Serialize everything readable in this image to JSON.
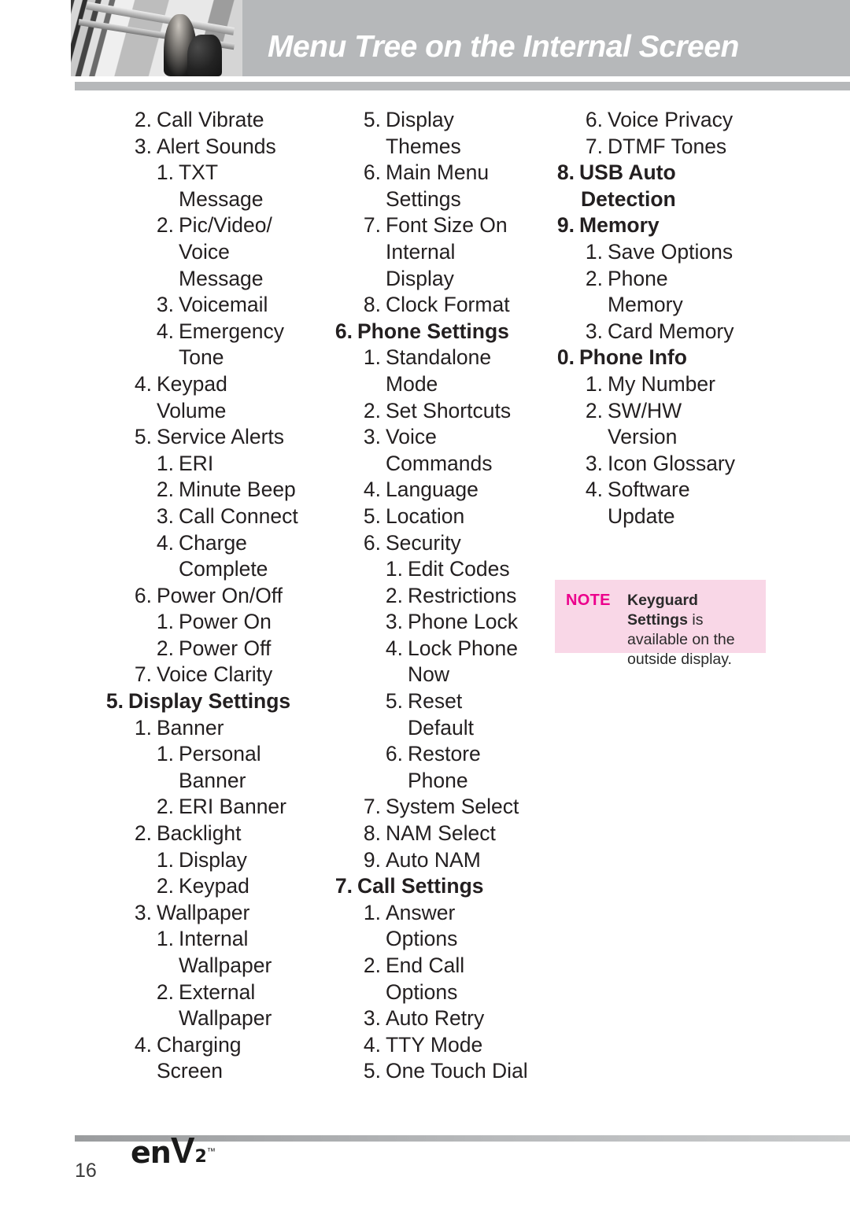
{
  "header": {
    "title": "Menu Tree on the Internal Screen",
    "photo_alt": "header-decorative-photo"
  },
  "columns": [
    {
      "id": "column-1",
      "entries": [
        {
          "level": 1,
          "num": "2.",
          "label": "Call Vibrate"
        },
        {
          "level": 1,
          "num": "3.",
          "label": "Alert Sounds"
        },
        {
          "level": 2,
          "num": "1.",
          "label": "TXT"
        },
        {
          "level": 2,
          "cont": true,
          "label": "Message"
        },
        {
          "level": 2,
          "num": "2.",
          "label": "Pic/Video/"
        },
        {
          "level": 2,
          "cont": true,
          "label": "Voice"
        },
        {
          "level": 2,
          "cont": true,
          "label": "Message"
        },
        {
          "level": 2,
          "num": "3.",
          "label": "Voicemail"
        },
        {
          "level": 2,
          "num": "4.",
          "label": "Emergency"
        },
        {
          "level": 2,
          "cont": true,
          "label": "Tone"
        },
        {
          "level": 1,
          "num": "4.",
          "label": "Keypad"
        },
        {
          "level": 1,
          "cont": true,
          "label": "Volume"
        },
        {
          "level": 1,
          "num": "5.",
          "label": "Service Alerts"
        },
        {
          "level": 2,
          "num": "1.",
          "label": "ERI"
        },
        {
          "level": 2,
          "num": "2.",
          "label": "Minute Beep"
        },
        {
          "level": 2,
          "num": "3.",
          "label": "Call Connect"
        },
        {
          "level": 2,
          "num": "4.",
          "label": "Charge"
        },
        {
          "level": 2,
          "cont": true,
          "label": "Complete"
        },
        {
          "level": 1,
          "num": "6.",
          "label": "Power On/Off"
        },
        {
          "level": 2,
          "num": "1.",
          "label": "Power On"
        },
        {
          "level": 2,
          "num": "2.",
          "label": "Power Off"
        },
        {
          "level": 1,
          "num": "7.",
          "label": "Voice Clarity"
        },
        {
          "level": 0,
          "num": "5.",
          "label": "Display Settings",
          "bold": true
        },
        {
          "level": 1,
          "num": "1.",
          "label": "Banner"
        },
        {
          "level": 2,
          "num": "1.",
          "label": "Personal"
        },
        {
          "level": 2,
          "cont": true,
          "label": "Banner"
        },
        {
          "level": 2,
          "num": "2.",
          "label": "ERI Banner"
        },
        {
          "level": 1,
          "num": "2.",
          "label": "Backlight"
        },
        {
          "level": 2,
          "num": "1.",
          "label": "Display"
        },
        {
          "level": 2,
          "num": "2.",
          "label": "Keypad"
        },
        {
          "level": 1,
          "num": "3.",
          "label": "Wallpaper"
        },
        {
          "level": 2,
          "num": "1.",
          "label": "Internal"
        },
        {
          "level": 2,
          "cont": true,
          "label": "Wallpaper"
        },
        {
          "level": 2,
          "num": "2.",
          "label": "External"
        },
        {
          "level": 2,
          "cont": true,
          "label": "Wallpaper"
        },
        {
          "level": 1,
          "num": "4.",
          "label": "Charging"
        },
        {
          "level": 1,
          "cont": true,
          "label": "Screen"
        }
      ]
    },
    {
      "id": "column-2",
      "entries": [
        {
          "level": 1,
          "num": "5.",
          "label": "Display"
        },
        {
          "level": 1,
          "cont": true,
          "label": "Themes"
        },
        {
          "level": 1,
          "num": "6.",
          "label": "Main Menu"
        },
        {
          "level": 1,
          "cont": true,
          "label": "Settings"
        },
        {
          "level": 1,
          "num": "7.",
          "label": "Font Size On"
        },
        {
          "level": 1,
          "cont": true,
          "label": "Internal"
        },
        {
          "level": 1,
          "cont": true,
          "label": "Display"
        },
        {
          "level": 1,
          "num": "8.",
          "label": "Clock Format"
        },
        {
          "level": 0,
          "num": "6.",
          "label": "Phone Settings",
          "bold": true
        },
        {
          "level": 1,
          "num": "1.",
          "label": "Standalone"
        },
        {
          "level": 1,
          "cont": true,
          "label": "Mode"
        },
        {
          "level": 1,
          "num": "2.",
          "label": "Set Shortcuts"
        },
        {
          "level": 1,
          "num": "3.",
          "label": "Voice"
        },
        {
          "level": 1,
          "cont": true,
          "label": "Commands"
        },
        {
          "level": 1,
          "num": "4.",
          "label": "Language"
        },
        {
          "level": 1,
          "num": "5.",
          "label": "Location"
        },
        {
          "level": 1,
          "num": "6.",
          "label": "Security"
        },
        {
          "level": 2,
          "num": "1.",
          "label": "Edit Codes"
        },
        {
          "level": 2,
          "num": "2.",
          "label": "Restrictions"
        },
        {
          "level": 2,
          "num": "3.",
          "label": "Phone Lock"
        },
        {
          "level": 2,
          "num": "4.",
          "label": "Lock Phone"
        },
        {
          "level": 2,
          "cont": true,
          "label": "Now"
        },
        {
          "level": 2,
          "num": "5.",
          "label": "Reset"
        },
        {
          "level": 2,
          "cont": true,
          "label": "Default"
        },
        {
          "level": 2,
          "num": "6.",
          "label": "Restore"
        },
        {
          "level": 2,
          "cont": true,
          "label": "Phone"
        },
        {
          "level": 1,
          "num": "7.",
          "label": "System Select"
        },
        {
          "level": 1,
          "num": "8.",
          "label": "NAM Select"
        },
        {
          "level": 1,
          "num": "9.",
          "label": "Auto NAM"
        },
        {
          "level": 0,
          "num": "7.",
          "label": "Call Settings",
          "bold": true
        },
        {
          "level": 1,
          "num": "1.",
          "label": "Answer"
        },
        {
          "level": 1,
          "cont": true,
          "label": "Options"
        },
        {
          "level": 1,
          "num": "2.",
          "label": "End Call"
        },
        {
          "level": 1,
          "cont": true,
          "label": "Options"
        },
        {
          "level": 1,
          "num": "3.",
          "label": "Auto Retry"
        },
        {
          "level": 1,
          "num": "4.",
          "label": "TTY Mode"
        },
        {
          "level": 1,
          "num": "5.",
          "label": "One Touch Dial"
        }
      ]
    },
    {
      "id": "column-3",
      "entries": [
        {
          "level": 1,
          "num": "6.",
          "label": "Voice Privacy"
        },
        {
          "level": 1,
          "num": "7.",
          "label": "DTMF Tones"
        },
        {
          "level": 0,
          "num": "8.",
          "label": "USB Auto",
          "bold": true
        },
        {
          "level": 0,
          "cont": true,
          "label": "Detection",
          "bold": true
        },
        {
          "level": 0,
          "num": "9.",
          "label": "Memory",
          "bold": true
        },
        {
          "level": 1,
          "num": "1.",
          "label": "Save Options"
        },
        {
          "level": 1,
          "num": "2.",
          "label": "Phone"
        },
        {
          "level": 1,
          "cont": true,
          "label": "Memory"
        },
        {
          "level": 1,
          "num": "3.",
          "label": "Card Memory"
        },
        {
          "level": 0,
          "num": "0.",
          "label": "Phone Info",
          "bold": true
        },
        {
          "level": 1,
          "num": "1.",
          "label": "My Number"
        },
        {
          "level": 1,
          "num": "2.",
          "label": "SW/HW"
        },
        {
          "level": 1,
          "cont": true,
          "label": "Version"
        },
        {
          "level": 1,
          "num": "3.",
          "label": "Icon Glossary"
        },
        {
          "level": 1,
          "num": "4.",
          "label": "Software"
        },
        {
          "level": 1,
          "cont": true,
          "label": "Update"
        }
      ]
    }
  ],
  "note": {
    "label": "NOTE",
    "bold_text": "Keyguard Settings",
    "body_text": " is available on the outside display."
  },
  "footer": {
    "page_number": "16",
    "brand_en": "en",
    "brand_v": "V",
    "brand_superscript": "2",
    "brand_tm": "™"
  },
  "colors": {
    "header_band": "#b6b8ba",
    "title_text": "#ffffff",
    "body_text": "#231f20",
    "note_bg": "#f9d7e7",
    "note_label": "#ec008c"
  }
}
